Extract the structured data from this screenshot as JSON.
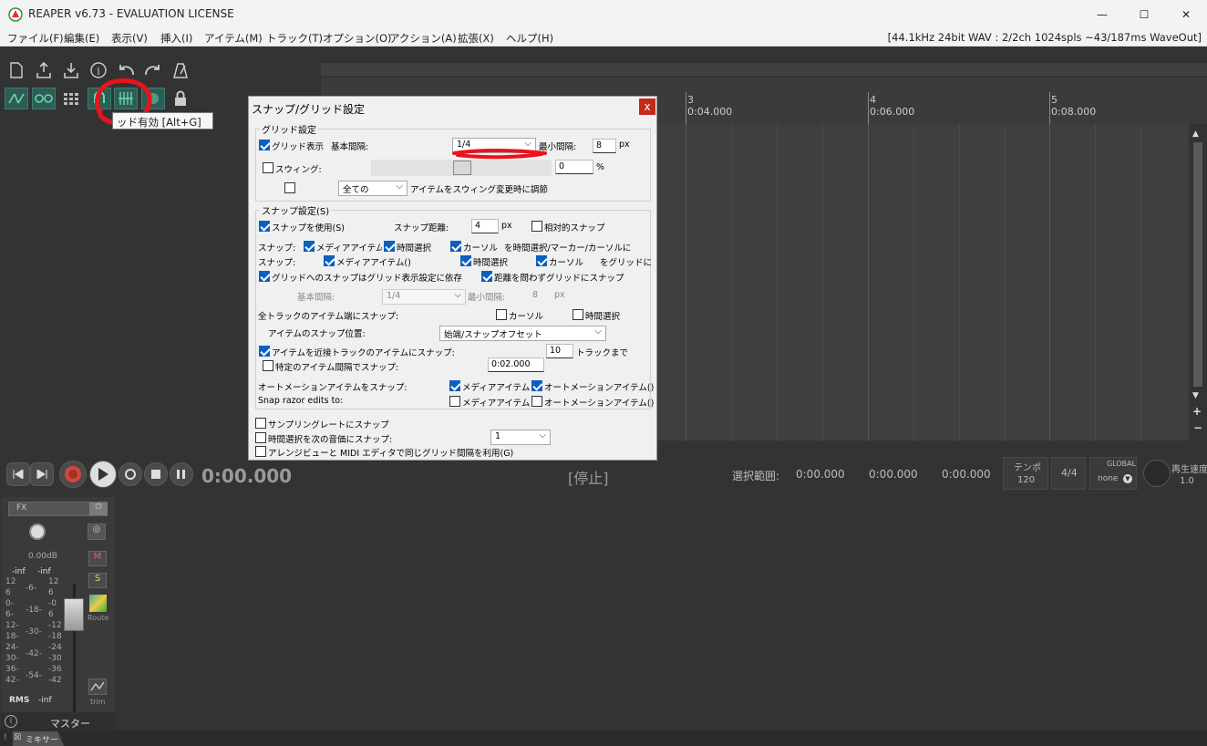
{
  "window": {
    "title": "REAPER v6.73 - EVALUATION LICENSE",
    "minimize": "—",
    "maximize": "☐",
    "close": "✕"
  },
  "menu": [
    "ファイル(F)",
    "編集(E)",
    "表示(V)",
    "挿入(I)",
    "アイテム(M)",
    "トラック(T)",
    "オプション(O)",
    "アクション(A)",
    "拡張(X)",
    "ヘルプ(H)"
  ],
  "audio_status": "[44.1kHz 24bit WAV : 2/2ch 1024spls ~43/187ms WaveOut]",
  "tooltip": "ッド有効 [Alt+G]",
  "ruler": {
    "bars": [
      {
        "num": "3",
        "time": "0:04.000"
      },
      {
        "num": "4",
        "time": "0:06.000"
      },
      {
        "num": "5",
        "time": "0:08.000"
      }
    ]
  },
  "transport": {
    "time": "0:00.000",
    "status": "[停止]",
    "selection_label": "選択範囲:",
    "sel_start": "0:00.000",
    "sel_end": "0:00.000",
    "sel_len": "0:00.000",
    "tempo_label": "テンポ",
    "tempo": "120",
    "timesig": "4/4",
    "global_label": "GLOBAL",
    "global_value": "none",
    "rate_label": "再生速度",
    "rate_value": "1.0"
  },
  "master": {
    "fx": "FX",
    "volume": "0.00dB",
    "peak_l": "-inf",
    "peak_r": "-inf",
    "mute": "M",
    "solo": "S",
    "route": "Route",
    "trim": "trim",
    "rms": "RMS",
    "rms_value": "-inf",
    "name": "マスター",
    "scale_left": [
      "12",
      "6",
      "0-",
      "6-",
      "12-",
      "18-",
      "24-",
      "30-",
      "36-",
      "42-"
    ],
    "scale_mid": [
      "-6-",
      "-18-",
      "-30-",
      "-42-",
      "-54-"
    ],
    "scale_right": [
      "12",
      "6",
      "-0",
      "6",
      "-12",
      "-18",
      "-24",
      "-30",
      "-36",
      "-42"
    ]
  },
  "mixer_tab": "ミキサー",
  "dialog": {
    "title": "スナップ/グリッド設定",
    "close": "x",
    "grid_group": "グリッド設定",
    "grid_show": "グリッド表示",
    "base_interval_label": "基本間隔:",
    "base_interval": "1/4",
    "min_interval_label": "最小間隔:",
    "min_interval": "8",
    "px": "px",
    "swing": "スウィング:",
    "swing_value": "0",
    "percent": "%",
    "swing_scope": "全ての",
    "swing_adjust": "アイテムをスウィング変更時に調節",
    "snap_group": "スナップ設定(S)",
    "use_snap": "スナップを使用(S)",
    "snap_distance_label": "スナップ距離:",
    "snap_distance": "4",
    "relative_snap": "相対的スナップ",
    "snap1_label": "スナップ:",
    "media_item1": "メディアアイテム()",
    "time_sel1": "時間選択",
    "cursor1": "カーソル",
    "snap1_suffix": "を時間選択/マーカー/カーソルに",
    "snap2_label": "スナップ:",
    "media_item2": "メディアアイテム()",
    "time_sel2": "時間選択",
    "cursor2": "カーソル",
    "snap2_suffix": "をグリッドに",
    "grid_snap_depends": "グリッドへのスナップはグリッド表示設定に依存",
    "snap_regardless": "距離を問わずグリッドにスナップ",
    "base_interval2_label": "基本間隔:",
    "base_interval2": "1/4",
    "min_interval2_label": "最小間隔:",
    "min_interval2": "8",
    "px2": "px",
    "all_track_edges": "全トラックのアイテム端にスナップ:",
    "edge_cursor": "カーソル",
    "edge_time_sel": "時間選択",
    "item_snap_pos_label": "アイテムのスナップ位置:",
    "item_snap_pos": "始端/スナップオフセット",
    "snap_adjacent": "アイテムを近接トラックのアイテムにスナップ:",
    "adjacent_tracks": "10",
    "tracks_until": "トラックまで",
    "snap_interval": "特定のアイテム間隔でスナップ:",
    "snap_interval_value": "0:02.000",
    "automation_label": "オートメーションアイテムをスナップ:",
    "auto_media": "メディアアイテム()",
    "auto_auto": "オートメーションアイテム()",
    "razor_label": "Snap razor edits to:",
    "razor_media": "メディアアイテム()",
    "razor_auto": "オートメーションアイテム()",
    "sample_rate": "サンプリングレートにスナップ",
    "next_transient": "時間選択を次の音価にスナップ:",
    "next_transient_value": "1",
    "same_grid": "アレンジビューと MIDI エディタで同じグリッド間隔を利用(G)"
  },
  "colors": {
    "accent": "#0b5fbe",
    "annotation": "#e8141b",
    "tb_green": "#2e5d55"
  }
}
